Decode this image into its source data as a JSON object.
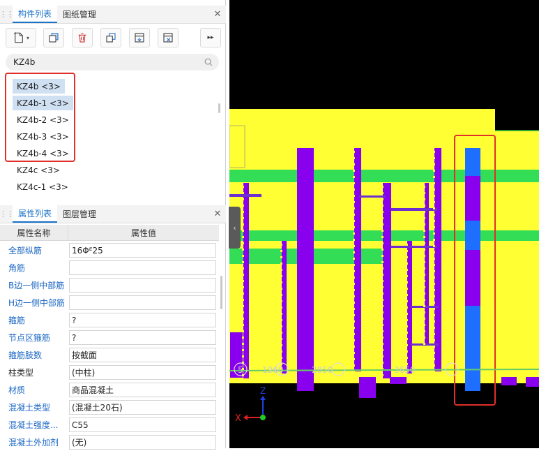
{
  "top_panel": {
    "tabs": [
      {
        "label": "构件列表"
      },
      {
        "label": "图纸管理"
      }
    ],
    "close_label": "✕",
    "search": {
      "value": "KZ4b",
      "placeholder": ""
    },
    "components": [
      {
        "label": "KZ4b <3>",
        "selected": true
      },
      {
        "label": "KZ4b-1 <3>",
        "selected": true
      },
      {
        "label": "KZ4b-2 <3>",
        "selected": false
      },
      {
        "label": "KZ4b-3 <3>",
        "selected": false
      },
      {
        "label": "KZ4b-4 <3>",
        "selected": false
      },
      {
        "label": "KZ4c <3>",
        "selected": false
      },
      {
        "label": "KZ4c-1 <3>",
        "selected": false
      }
    ]
  },
  "prop_panel": {
    "tabs": [
      {
        "label": "属性列表"
      },
      {
        "label": "图层管理"
      }
    ],
    "close_label": "✕",
    "col_name": "属性名称",
    "col_value": "属性值",
    "rows": [
      {
        "name": "全部纵筋",
        "value": "16Φᴱ25",
        "blue": true
      },
      {
        "name": "角筋",
        "value": "",
        "blue": true
      },
      {
        "name": "B边一侧中部筋",
        "value": "",
        "blue": true
      },
      {
        "name": "H边一侧中部筋",
        "value": "",
        "blue": true
      },
      {
        "name": "箍筋",
        "value": "?",
        "blue": true
      },
      {
        "name": "节点区箍筋",
        "value": "?",
        "blue": true
      },
      {
        "name": "箍筋肢数",
        "value": "按截面",
        "blue": true
      },
      {
        "name": "柱类型",
        "value": "(中柱)",
        "blue": false
      },
      {
        "name": "材质",
        "value": "商品混凝土",
        "blue": true
      },
      {
        "name": "混凝土类型",
        "value": "(混凝土20石)",
        "blue": true
      },
      {
        "name": "混凝土强度...",
        "value": "C55",
        "blue": true
      },
      {
        "name": "混凝土外加剂",
        "value": "(无)",
        "blue": true
      }
    ]
  },
  "viewport": {
    "axis_labels": {
      "x": "X",
      "z": "Z"
    },
    "grid_labels": [
      "5",
      "1960",
      "2850",
      "3650"
    ],
    "colors": {
      "background": "#000000",
      "slab": "#ffff33",
      "beam": "#33dd55",
      "column": "#8800ee",
      "highlight": "#1e6fff",
      "annotation": "#e0302a"
    }
  }
}
